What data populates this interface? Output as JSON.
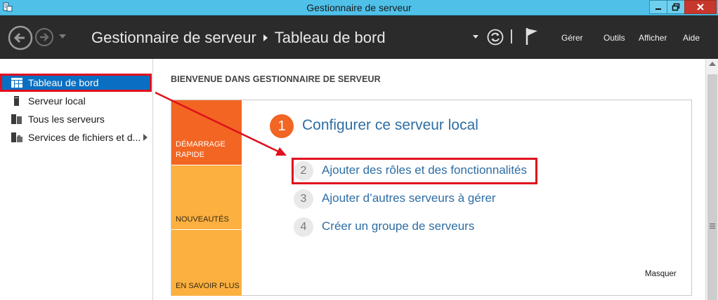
{
  "window": {
    "title": "Gestionnaire de serveur",
    "app_icon": "server-manager-icon",
    "controls": [
      "minimize-icon",
      "restore-icon",
      "close-icon"
    ]
  },
  "header": {
    "breadcrumb": [
      "Gestionnaire de serveur",
      "Tableau de bord"
    ],
    "menus": [
      "Gérer",
      "Outils",
      "Afficher",
      "Aide"
    ],
    "icons": [
      "back-arrow-icon",
      "forward-arrow-icon",
      "chevron-down-icon",
      "refresh-icon",
      "flag-icon"
    ]
  },
  "sidebar": {
    "items": [
      {
        "label": "Tableau de bord",
        "icon": "dashboard-icon",
        "selected": true
      },
      {
        "label": "Serveur local",
        "icon": "server-icon"
      },
      {
        "label": "Tous les serveurs",
        "icon": "servers-icon"
      },
      {
        "label": "Services de fichiers et d...",
        "icon": "file-services-icon"
      }
    ]
  },
  "main": {
    "welcome_title": "BIENVENUE DANS GESTIONNAIRE DE SERVEUR",
    "tiles": [
      {
        "label": "DÉMARRAGE RAPIDE",
        "color": "#f26522"
      },
      {
        "label": "NOUVEAUTÉS",
        "color": "#fbb040"
      },
      {
        "label": "EN SAVOIR PLUS",
        "color": "#fbb040"
      }
    ],
    "steps": [
      {
        "num": "1",
        "label": "Configurer ce serveur local"
      },
      {
        "num": "2",
        "label": "Ajouter des rôles et des fonctionnalités"
      },
      {
        "num": "3",
        "label": "Ajouter d’autres serveurs à gérer"
      },
      {
        "num": "4",
        "label": "Créer un groupe de serveurs"
      }
    ],
    "hide_label": "Masquer"
  },
  "colors": {
    "title_bar": "#4fc1e9",
    "header_bg": "#2b2b2b",
    "selection": "#0a6fc2",
    "annotation_red": "#e0101e",
    "link_blue": "#2e6da4"
  }
}
